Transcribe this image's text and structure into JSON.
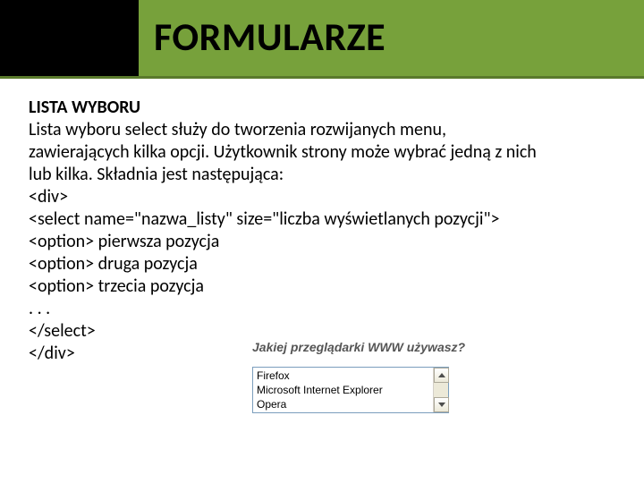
{
  "header": {
    "title": "FORMULARZE"
  },
  "content": {
    "subtitle": "LISTA WYBORU",
    "lines": [
      "Lista wyboru select służy do tworzenia rozwijanych menu,",
      "zawierających kilka opcji. Użytkownik strony może wybrać jedną z nich",
      "lub kilka. Składnia jest następująca:",
      "<div>",
      "<select name=\"nazwa_listy\" size=\"liczba wyświetlanych pozycji\">",
      "<option> pierwsza pozycja",
      "<option> druga pozycja",
      "<option> trzecia pozycja",
      ". . .",
      "</select>",
      "</div>"
    ]
  },
  "example": {
    "label": "Jakiej przeglądarki WWW używasz?",
    "items": [
      "Firefox",
      "Microsoft Internet Explorer",
      "Opera"
    ]
  }
}
